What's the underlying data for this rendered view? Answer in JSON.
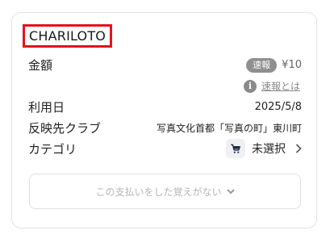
{
  "merchant": "CHARILOTO",
  "amount": {
    "label": "金額",
    "badge": "速報",
    "value": "¥10",
    "info_link": "速報とは"
  },
  "date": {
    "label": "利用日",
    "value": "2025/5/8"
  },
  "club": {
    "label": "反映先クラブ",
    "value": "写真文化首都「写真の町」東川町"
  },
  "category": {
    "label": "カテゴリ",
    "value": "未選択",
    "icon": "cart-icon"
  },
  "dispute_button": "この支払いをした覚えがない",
  "colors": {
    "highlight": "#e8111b",
    "badge": "#8f8f8f"
  }
}
